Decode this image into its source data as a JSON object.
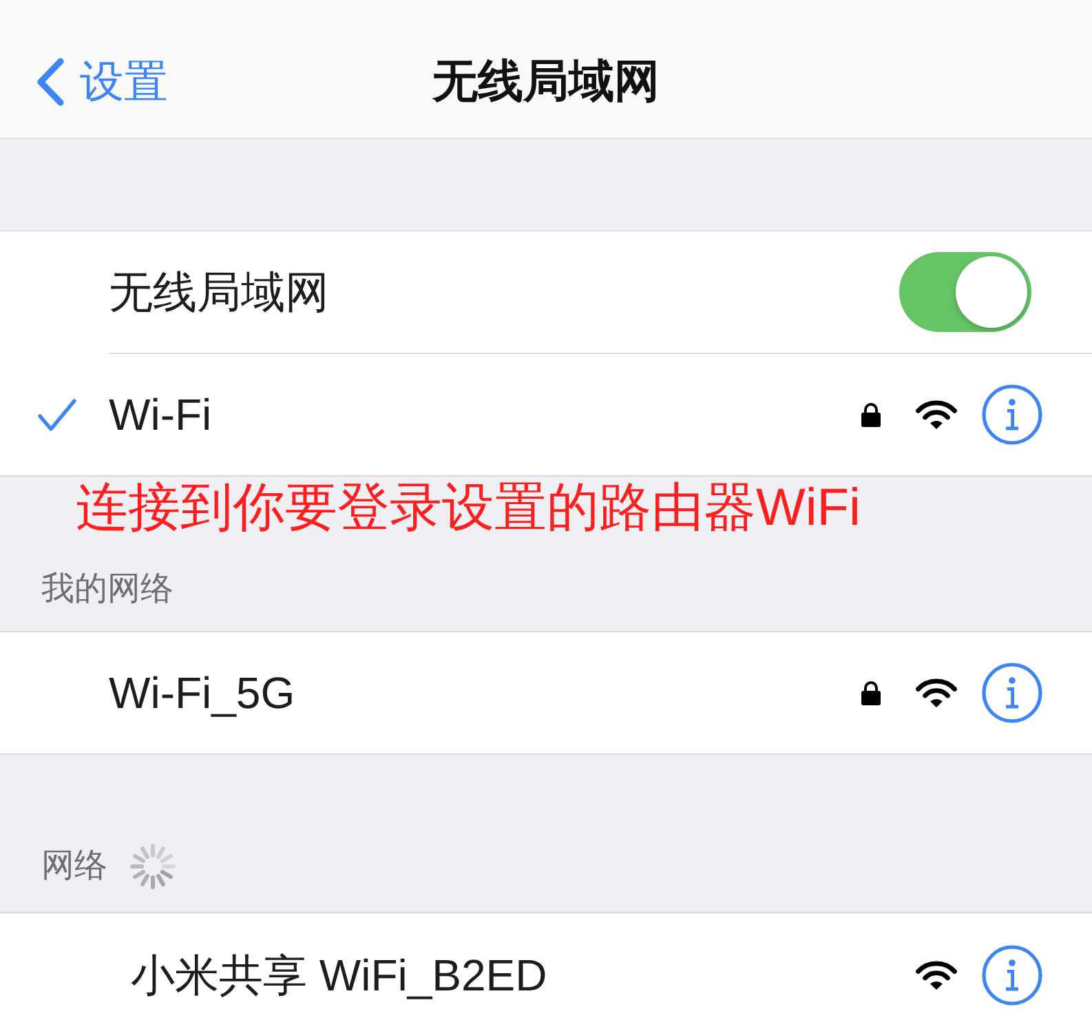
{
  "nav_bar": {
    "back_label": "设置",
    "title": "无线局域网"
  },
  "wifi_section": {
    "toggle": {
      "label": "无线局域网",
      "on": true
    },
    "current_network": {
      "name": "Wi-Fi",
      "checked": true,
      "locked": true
    }
  },
  "annotation": "连接到你要登录设置的路由器WiFi",
  "my_networks": {
    "header": "我的网络",
    "networks": [
      {
        "name": "Wi-Fi_5G",
        "locked": true
      }
    ]
  },
  "other_networks": {
    "header": "网络",
    "loading": true,
    "networks": [
      {
        "name": "小米共享 WiFi_B2ED",
        "locked": false
      }
    ]
  }
}
